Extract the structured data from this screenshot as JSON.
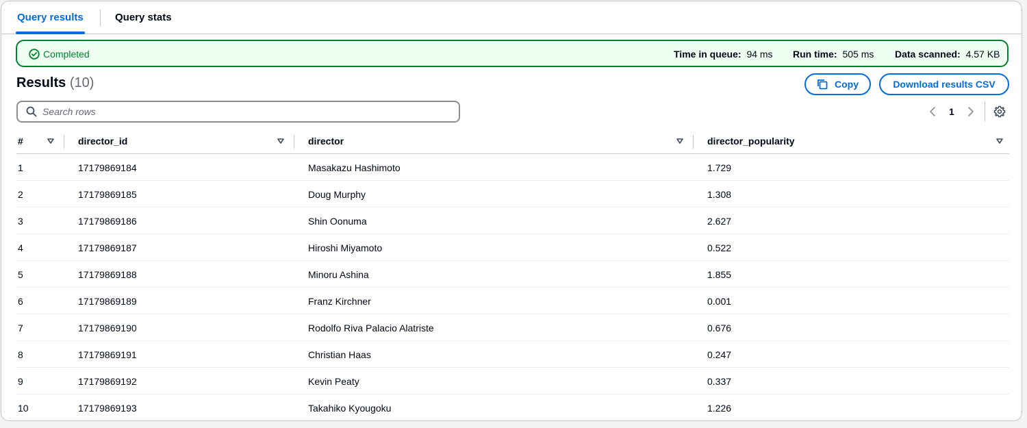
{
  "tabs": [
    {
      "label": "Query results",
      "active": true
    },
    {
      "label": "Query stats",
      "active": false
    }
  ],
  "status": {
    "text": "Completed",
    "icon": "check-circle-icon",
    "color": "#00802f",
    "time_in_queue_label": "Time in queue:",
    "time_in_queue_value": "94 ms",
    "run_time_label": "Run time:",
    "run_time_value": "505 ms",
    "data_scanned_label": "Data scanned:",
    "data_scanned_value": "4.57 KB"
  },
  "results": {
    "title": "Results",
    "count": "(10)",
    "copy_label": "Copy",
    "download_label": "Download results CSV"
  },
  "search": {
    "placeholder": "Search rows",
    "value": ""
  },
  "pagination": {
    "current_page": "1"
  },
  "table": {
    "columns": [
      "#",
      "director_id",
      "director",
      "director_popularity"
    ],
    "rows": [
      [
        "1",
        "17179869184",
        "Masakazu Hashimoto",
        "1.729"
      ],
      [
        "2",
        "17179869185",
        "Doug Murphy",
        "1.308"
      ],
      [
        "3",
        "17179869186",
        "Shin Oonuma",
        "2.627"
      ],
      [
        "4",
        "17179869187",
        "Hiroshi Miyamoto",
        "0.522"
      ],
      [
        "5",
        "17179869188",
        "Minoru Ashina",
        "1.855"
      ],
      [
        "6",
        "17179869189",
        "Franz Kirchner",
        "0.001"
      ],
      [
        "7",
        "17179869190",
        "Rodolfo Riva Palacio Alatriste",
        "0.676"
      ],
      [
        "8",
        "17179869191",
        "Christian Haas",
        "0.247"
      ],
      [
        "9",
        "17179869192",
        "Kevin Peaty",
        "0.337"
      ],
      [
        "10",
        "17179869193",
        "Takahiko Kyougoku",
        "1.226"
      ]
    ]
  },
  "colors": {
    "accent": "#006ce0",
    "success": "#00802f",
    "success_bg": "#effff1",
    "border": "#c6c6cd"
  }
}
